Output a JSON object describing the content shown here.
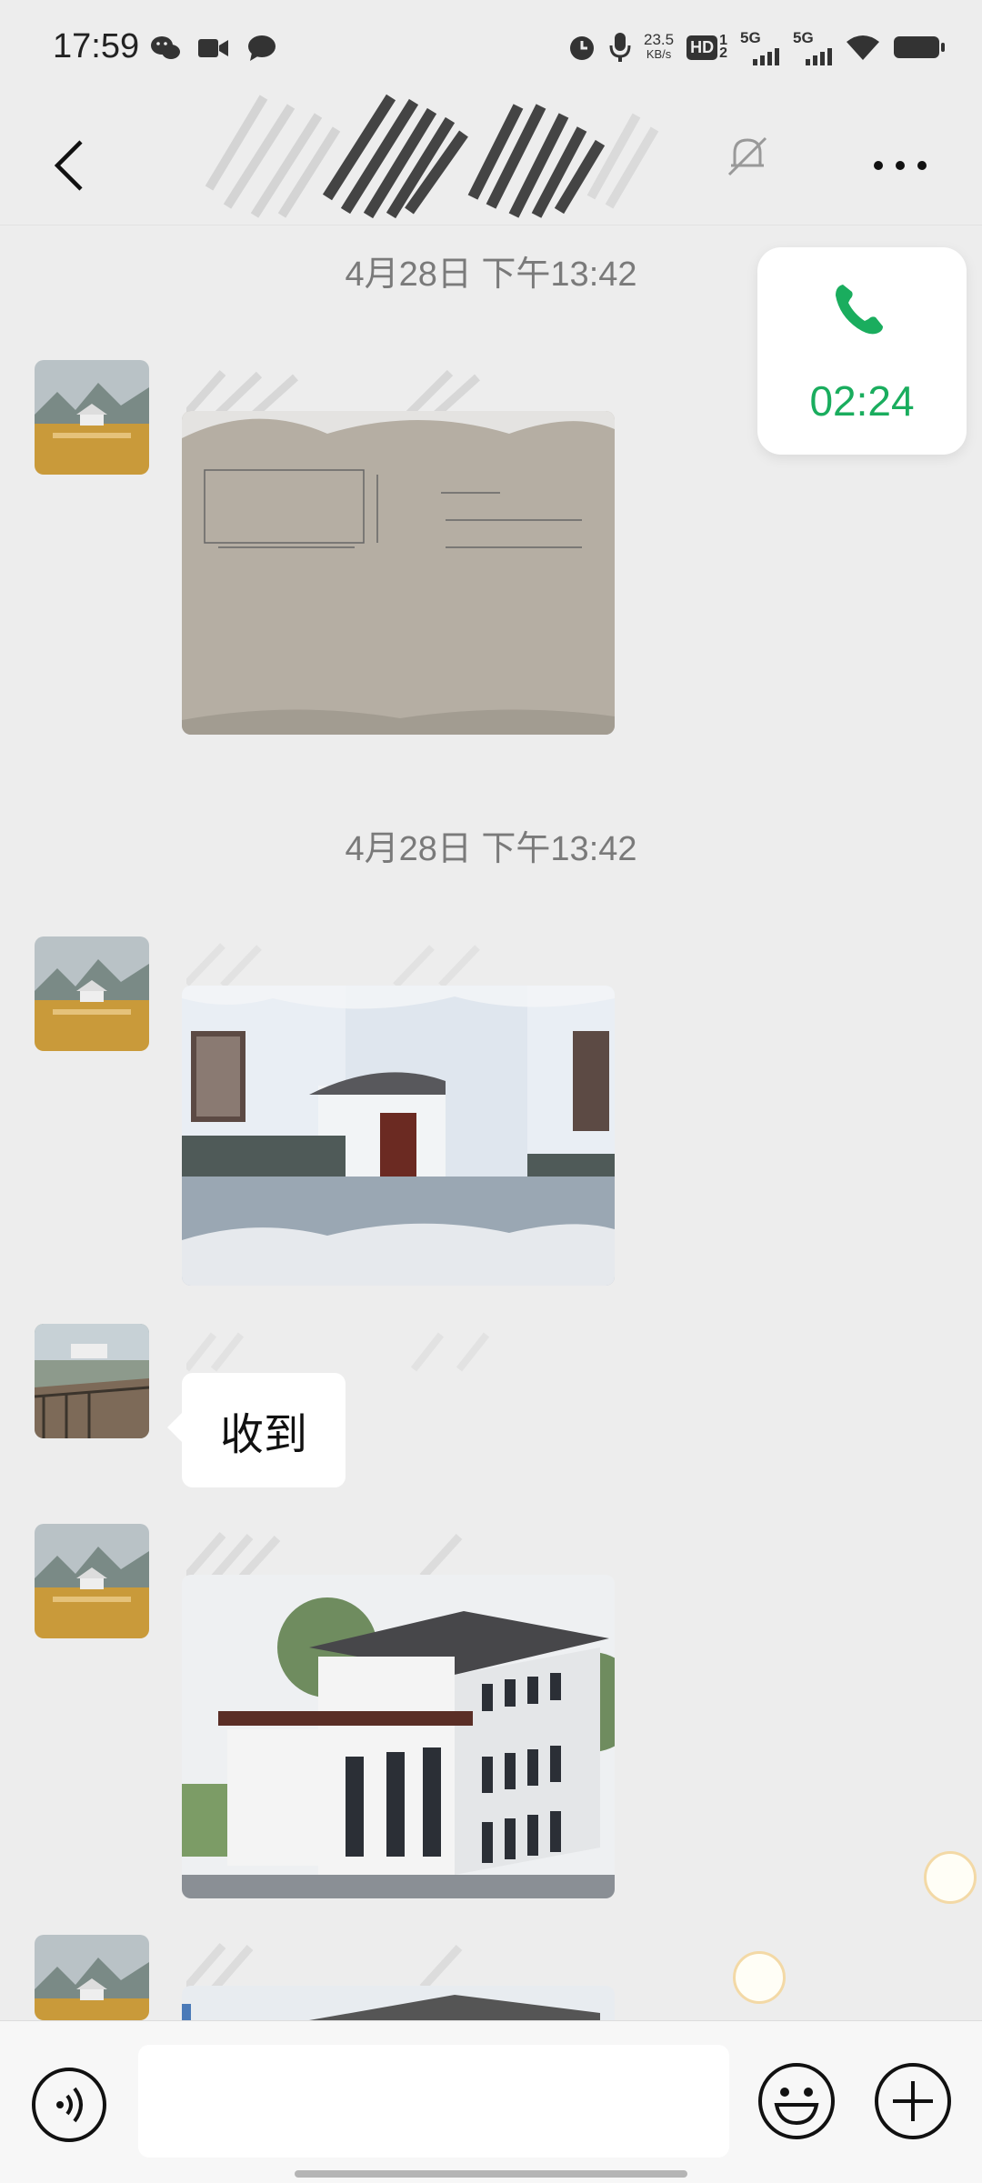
{
  "status_bar": {
    "time": "17:59",
    "net_speed_value": "23.5",
    "net_speed_unit": "KB/s",
    "hd_label": "HD",
    "sim1": "5G",
    "sim2": "5G",
    "left_icons": [
      "wechat-icon",
      "video-icon",
      "message-icon"
    ],
    "right_icons": [
      "alarm-icon",
      "mic-icon",
      "hd-icon",
      "signal-icon",
      "wifi-icon",
      "battery-icon"
    ]
  },
  "header": {
    "back_icon": "chevron-left-icon",
    "mute_icon": "bell-muted-icon",
    "more_icon": "more-dots-icon"
  },
  "messages": [
    {
      "timestamp": "4月28日 下午13:42"
    },
    {
      "timestamp": "4月28日 下午13:42"
    }
  ],
  "text_messages": [
    "收到"
  ],
  "call": {
    "duration": "02:24",
    "accent": "#1aad5e"
  },
  "input_bar": {
    "voice_icon": "voice-icon",
    "emoji_icon": "emoji-icon",
    "plus_icon": "plus-icon",
    "input_value": ""
  },
  "colors": {
    "background": "#ededed",
    "bubble": "#ffffff",
    "green": "#1aad5e"
  }
}
